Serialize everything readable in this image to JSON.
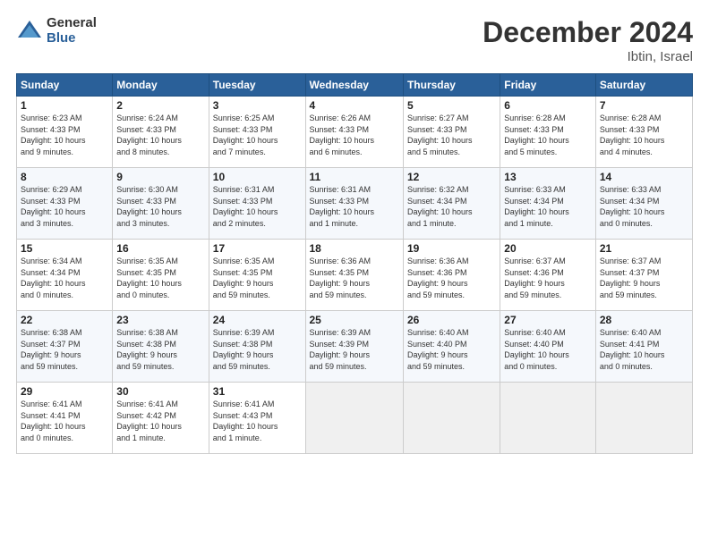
{
  "header": {
    "logo_general": "General",
    "logo_blue": "Blue",
    "month_title": "December 2024",
    "location": "Ibtin, Israel"
  },
  "days_of_week": [
    "Sunday",
    "Monday",
    "Tuesday",
    "Wednesday",
    "Thursday",
    "Friday",
    "Saturday"
  ],
  "weeks": [
    [
      {
        "day": "1",
        "info": "Sunrise: 6:23 AM\nSunset: 4:33 PM\nDaylight: 10 hours\nand 9 minutes."
      },
      {
        "day": "2",
        "info": "Sunrise: 6:24 AM\nSunset: 4:33 PM\nDaylight: 10 hours\nand 8 minutes."
      },
      {
        "day": "3",
        "info": "Sunrise: 6:25 AM\nSunset: 4:33 PM\nDaylight: 10 hours\nand 7 minutes."
      },
      {
        "day": "4",
        "info": "Sunrise: 6:26 AM\nSunset: 4:33 PM\nDaylight: 10 hours\nand 6 minutes."
      },
      {
        "day": "5",
        "info": "Sunrise: 6:27 AM\nSunset: 4:33 PM\nDaylight: 10 hours\nand 5 minutes."
      },
      {
        "day": "6",
        "info": "Sunrise: 6:28 AM\nSunset: 4:33 PM\nDaylight: 10 hours\nand 5 minutes."
      },
      {
        "day": "7",
        "info": "Sunrise: 6:28 AM\nSunset: 4:33 PM\nDaylight: 10 hours\nand 4 minutes."
      }
    ],
    [
      {
        "day": "8",
        "info": "Sunrise: 6:29 AM\nSunset: 4:33 PM\nDaylight: 10 hours\nand 3 minutes."
      },
      {
        "day": "9",
        "info": "Sunrise: 6:30 AM\nSunset: 4:33 PM\nDaylight: 10 hours\nand 3 minutes."
      },
      {
        "day": "10",
        "info": "Sunrise: 6:31 AM\nSunset: 4:33 PM\nDaylight: 10 hours\nand 2 minutes."
      },
      {
        "day": "11",
        "info": "Sunrise: 6:31 AM\nSunset: 4:33 PM\nDaylight: 10 hours\nand 1 minute."
      },
      {
        "day": "12",
        "info": "Sunrise: 6:32 AM\nSunset: 4:34 PM\nDaylight: 10 hours\nand 1 minute."
      },
      {
        "day": "13",
        "info": "Sunrise: 6:33 AM\nSunset: 4:34 PM\nDaylight: 10 hours\nand 1 minute."
      },
      {
        "day": "14",
        "info": "Sunrise: 6:33 AM\nSunset: 4:34 PM\nDaylight: 10 hours\nand 0 minutes."
      }
    ],
    [
      {
        "day": "15",
        "info": "Sunrise: 6:34 AM\nSunset: 4:34 PM\nDaylight: 10 hours\nand 0 minutes."
      },
      {
        "day": "16",
        "info": "Sunrise: 6:35 AM\nSunset: 4:35 PM\nDaylight: 10 hours\nand 0 minutes."
      },
      {
        "day": "17",
        "info": "Sunrise: 6:35 AM\nSunset: 4:35 PM\nDaylight: 9 hours\nand 59 minutes."
      },
      {
        "day": "18",
        "info": "Sunrise: 6:36 AM\nSunset: 4:35 PM\nDaylight: 9 hours\nand 59 minutes."
      },
      {
        "day": "19",
        "info": "Sunrise: 6:36 AM\nSunset: 4:36 PM\nDaylight: 9 hours\nand 59 minutes."
      },
      {
        "day": "20",
        "info": "Sunrise: 6:37 AM\nSunset: 4:36 PM\nDaylight: 9 hours\nand 59 minutes."
      },
      {
        "day": "21",
        "info": "Sunrise: 6:37 AM\nSunset: 4:37 PM\nDaylight: 9 hours\nand 59 minutes."
      }
    ],
    [
      {
        "day": "22",
        "info": "Sunrise: 6:38 AM\nSunset: 4:37 PM\nDaylight: 9 hours\nand 59 minutes."
      },
      {
        "day": "23",
        "info": "Sunrise: 6:38 AM\nSunset: 4:38 PM\nDaylight: 9 hours\nand 59 minutes."
      },
      {
        "day": "24",
        "info": "Sunrise: 6:39 AM\nSunset: 4:38 PM\nDaylight: 9 hours\nand 59 minutes."
      },
      {
        "day": "25",
        "info": "Sunrise: 6:39 AM\nSunset: 4:39 PM\nDaylight: 9 hours\nand 59 minutes."
      },
      {
        "day": "26",
        "info": "Sunrise: 6:40 AM\nSunset: 4:40 PM\nDaylight: 9 hours\nand 59 minutes."
      },
      {
        "day": "27",
        "info": "Sunrise: 6:40 AM\nSunset: 4:40 PM\nDaylight: 10 hours\nand 0 minutes."
      },
      {
        "day": "28",
        "info": "Sunrise: 6:40 AM\nSunset: 4:41 PM\nDaylight: 10 hours\nand 0 minutes."
      }
    ],
    [
      {
        "day": "29",
        "info": "Sunrise: 6:41 AM\nSunset: 4:41 PM\nDaylight: 10 hours\nand 0 minutes."
      },
      {
        "day": "30",
        "info": "Sunrise: 6:41 AM\nSunset: 4:42 PM\nDaylight: 10 hours\nand 1 minute."
      },
      {
        "day": "31",
        "info": "Sunrise: 6:41 AM\nSunset: 4:43 PM\nDaylight: 10 hours\nand 1 minute."
      },
      null,
      null,
      null,
      null
    ]
  ]
}
